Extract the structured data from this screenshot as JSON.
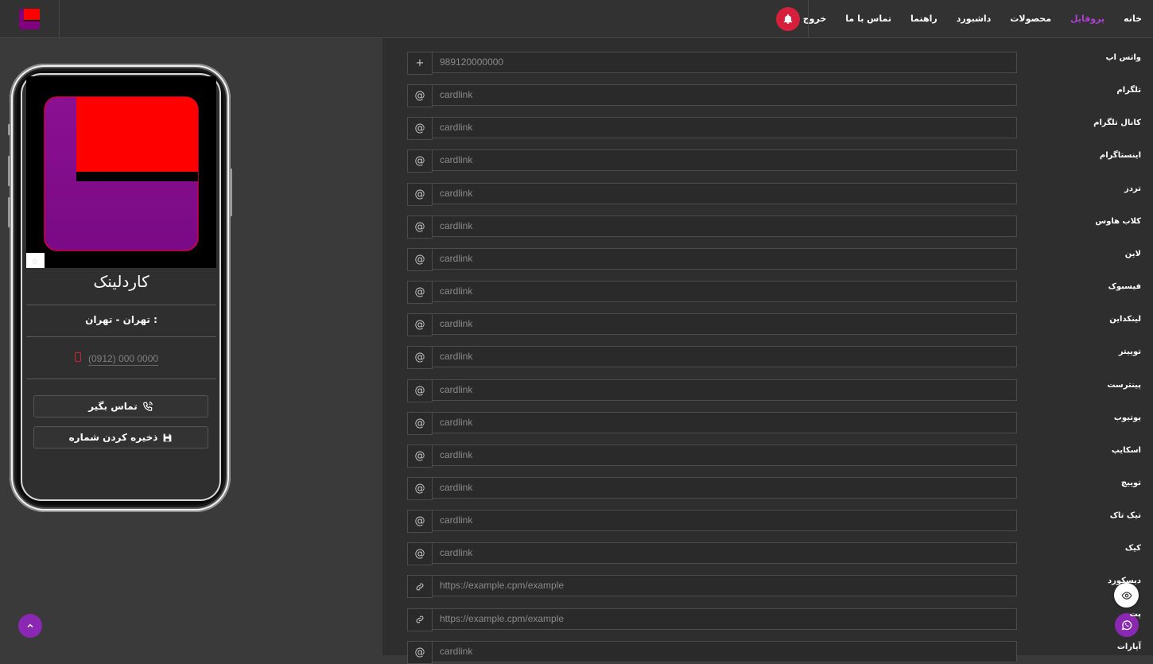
{
  "nav": {
    "items": [
      {
        "label": "خانه",
        "active": false
      },
      {
        "label": "پروفایل",
        "active": true
      },
      {
        "label": "محصولات",
        "active": false
      },
      {
        "label": "داشبورد",
        "active": false
      },
      {
        "label": "راهنما",
        "active": false
      },
      {
        "label": "تماس با ما",
        "active": false
      },
      {
        "label": "خروج",
        "active": false
      }
    ],
    "bell_icon": "bell-icon",
    "accent": "#b23fd6",
    "bell_color": "#d61f3b"
  },
  "card": {
    "name": "کاردلینک",
    "city": "تهران - تهران :",
    "phone_placeholder": "(0912) 000 0000",
    "call_button": "تماس بگیر",
    "save_button": "ذخیره کردن شماره"
  },
  "fields": [
    {
      "label": "واتس اپ",
      "prefix": "+",
      "placeholder": "989120000000"
    },
    {
      "label": "تلگرام",
      "prefix": "@",
      "placeholder": "cardlink"
    },
    {
      "label": "کانال تلگرام",
      "prefix": "@",
      "placeholder": "cardlink"
    },
    {
      "label": "اینستاگرام",
      "prefix": "@",
      "placeholder": "cardlink"
    },
    {
      "label": "تردز",
      "prefix": "@",
      "placeholder": "cardlink"
    },
    {
      "label": "کلاب هاوس",
      "prefix": "@",
      "placeholder": "cardlink"
    },
    {
      "label": "لاین",
      "prefix": "@",
      "placeholder": "cardlink"
    },
    {
      "label": "فیسبوک",
      "prefix": "@",
      "placeholder": "cardlink"
    },
    {
      "label": "لینکداین",
      "prefix": "@",
      "placeholder": "cardlink"
    },
    {
      "label": "توییتر",
      "prefix": "@",
      "placeholder": "cardlink"
    },
    {
      "label": "پینترست",
      "prefix": "@",
      "placeholder": "cardlink"
    },
    {
      "label": "یوتیوب",
      "prefix": "@",
      "placeholder": "cardlink"
    },
    {
      "label": "اسکایپ",
      "prefix": "@",
      "placeholder": "cardlink"
    },
    {
      "label": "توییچ",
      "prefix": "@",
      "placeholder": "cardlink"
    },
    {
      "label": "تیک تاک",
      "prefix": "@",
      "placeholder": "cardlink"
    },
    {
      "label": "کیک",
      "prefix": "@",
      "placeholder": "cardlink"
    },
    {
      "label": "دیسکورد",
      "prefix": "link",
      "placeholder": "https://example.cpm/example"
    },
    {
      "label": "پت",
      "prefix": "link",
      "placeholder": "https://example.cpm/example"
    },
    {
      "label": "آپارات",
      "prefix": "@",
      "placeholder": "cardlink"
    }
  ]
}
